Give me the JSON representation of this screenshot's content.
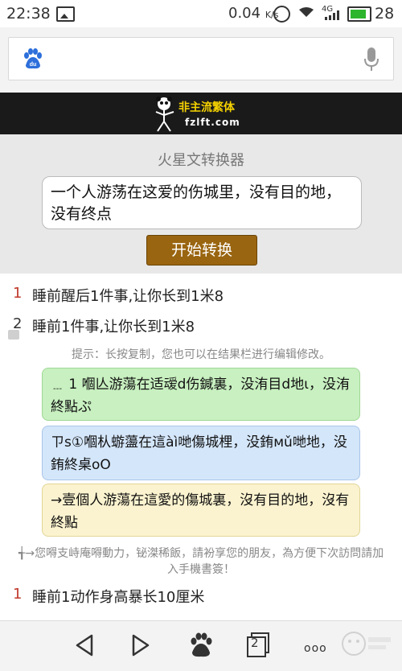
{
  "status_bar": {
    "time": "22:38",
    "speed": "0.04",
    "speed_unit": "K/s",
    "signal_label": "4G",
    "battery_level": 0.85,
    "battery_percent": "28"
  },
  "search_bar": {
    "placeholder": "",
    "baidu_icon_text": "du"
  },
  "banner": {
    "title": "非主流繁体",
    "url": "fzlft.com"
  },
  "converter": {
    "title": "火星文转换器",
    "input_value": "一个人游荡在这爱的伤城里，没有目的地，没有终点",
    "button_label": "开始转换"
  },
  "results_top": [
    {
      "num": "1",
      "text": "睡前醒后1件事,让你长到1米8"
    },
    {
      "num": "2",
      "text": "睡前1件事,让你长到1米8"
    }
  ],
  "hint": "提示：长按复制，您也可以在结果栏进行编辑修改。",
  "cards": [
    {
      "text": "﹍ 1 嗰亾游蕩在适叆d伤鍼裏，没洧目d地ι，没洧終點ぷ",
      "color": "#c8f0c0"
    },
    {
      "text": "ㄗs①嗰朲蝣蘯在這àì哋傷城梩，没銪мǔ哋地，没銪終桌oO",
      "color": "#d4e6fa"
    },
    {
      "text": "→壹個人游蕩在這愛的傷城裏，沒有目的地，沒有終點",
      "color": "#fbf3cf"
    }
  ],
  "footer_note": "╅→您嘚支峙庵嘚動力，铋滐稀飯，請衯享您的朋友，為方便下次訪問請加入手機書簽！",
  "results_bottom": [
    {
      "num": "1",
      "text": "睡前1动作身高暴长10厘米"
    }
  ],
  "bottom_nav": {
    "tabs_count": "2",
    "menu_label": "ooo"
  }
}
